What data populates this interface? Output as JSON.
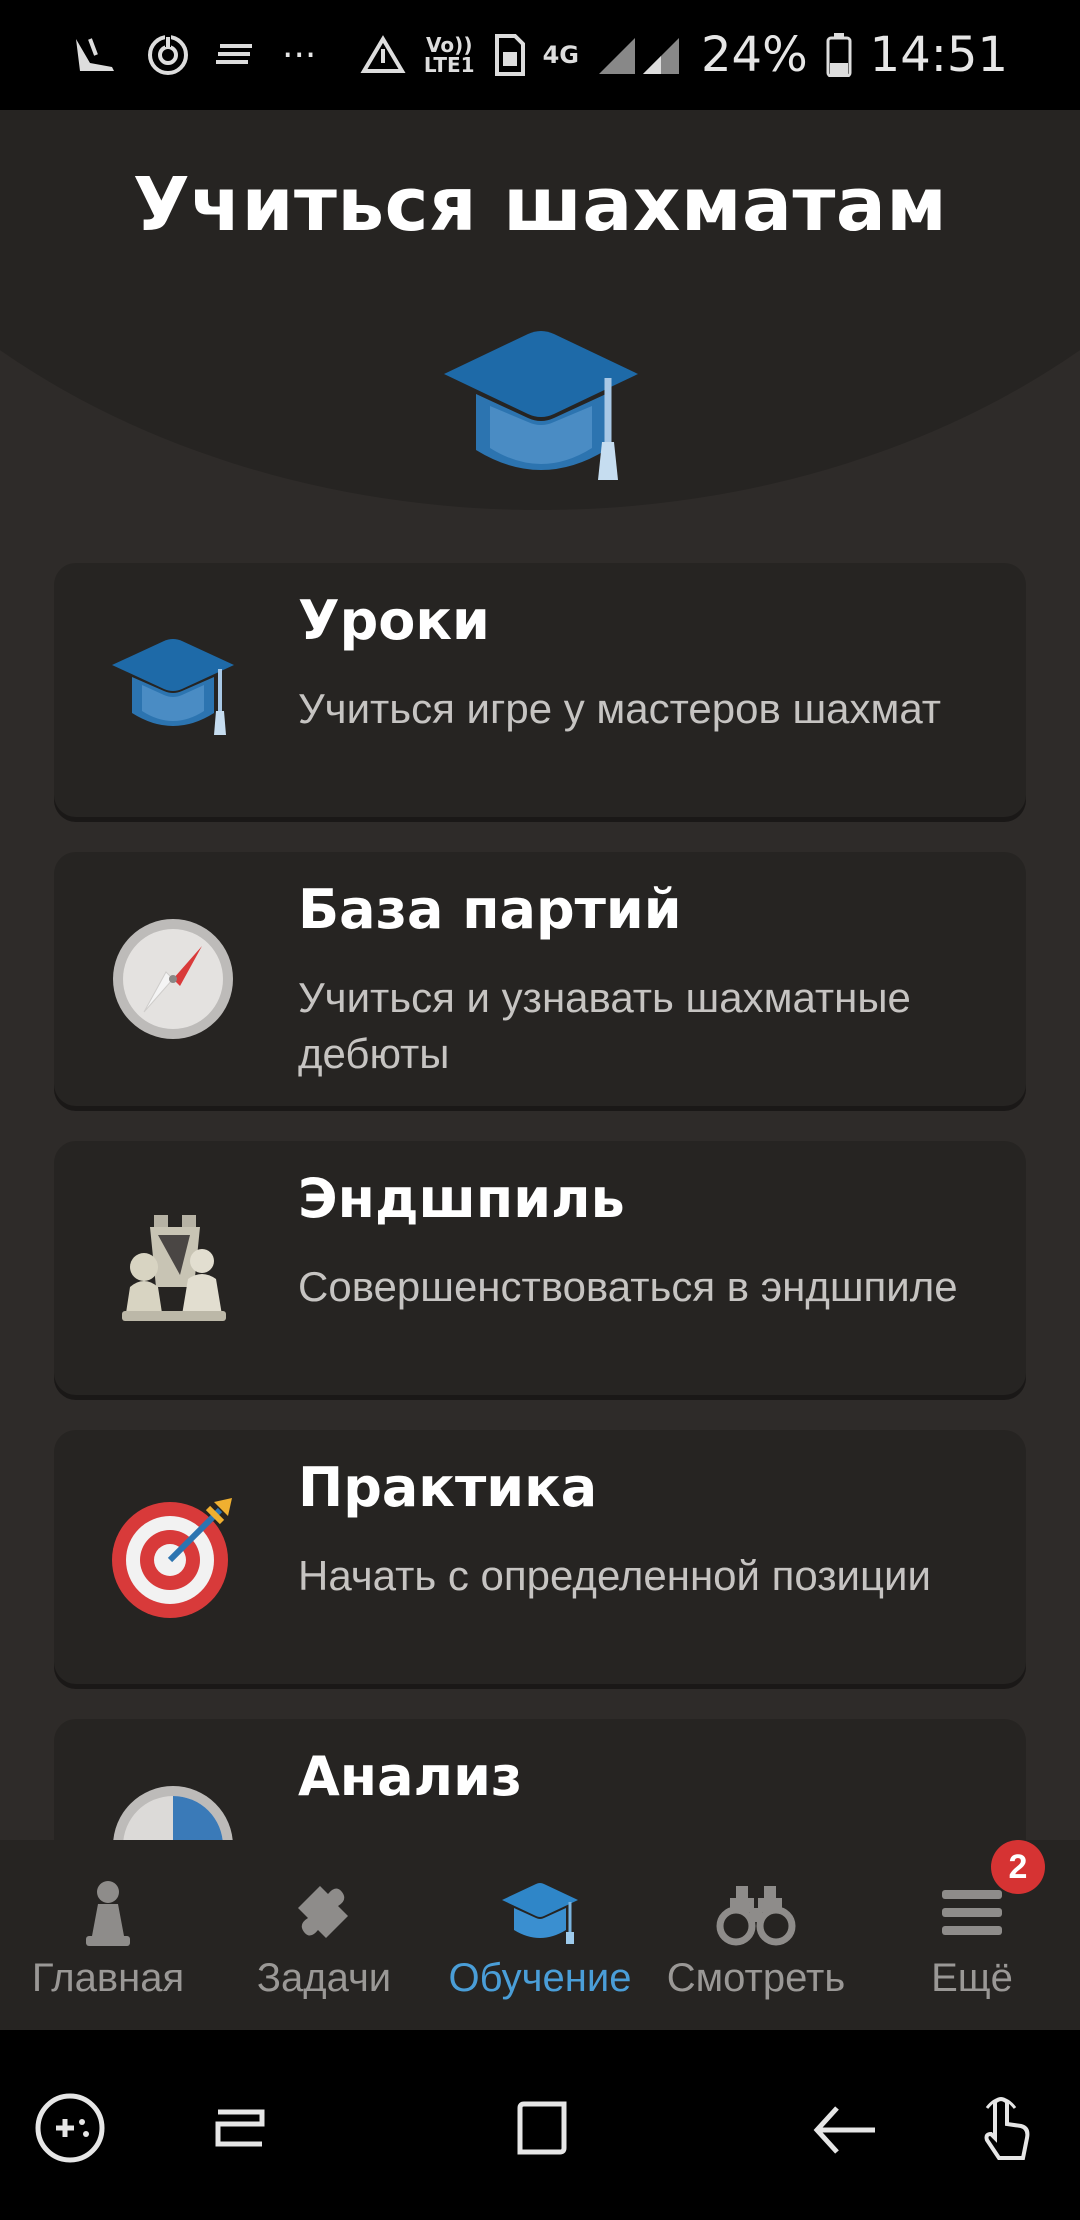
{
  "status_bar": {
    "battery": "24%",
    "time": "14:51",
    "volte": "Vo))",
    "lte": "LTE1",
    "network": "4G",
    "more": "···"
  },
  "header": {
    "title": "Учиться шахматам"
  },
  "cards": [
    {
      "title": "Уроки",
      "description": "Учиться игре у мастеров шахмат",
      "icon": "graduation-cap-icon"
    },
    {
      "title": "База партий",
      "description": "Учиться и узнавать шахматные дебюты",
      "icon": "compass-icon"
    },
    {
      "title": "Эндшпиль",
      "description": "Совершенствоваться в эндшпиле",
      "icon": "endgame-pieces-icon"
    },
    {
      "title": "Практика",
      "description": "Начать с определенной позиции",
      "icon": "target-icon"
    },
    {
      "title": "Анализ",
      "description": "",
      "icon": "analysis-icon"
    }
  ],
  "tabs": [
    {
      "label": "Главная",
      "icon": "pawn-icon",
      "active": false
    },
    {
      "label": "Задачи",
      "icon": "puzzle-icon",
      "active": false
    },
    {
      "label": "Обучение",
      "icon": "graduation-cap-icon",
      "active": true
    },
    {
      "label": "Смотреть",
      "icon": "binoculars-icon",
      "active": false
    },
    {
      "label": "Ещё",
      "icon": "menu-icon",
      "active": false
    }
  ],
  "more_badge": "2",
  "colors": {
    "accent": "#4a9ed8",
    "background": "#2e2b29",
    "card": "#262422",
    "badge": "#d63333"
  }
}
